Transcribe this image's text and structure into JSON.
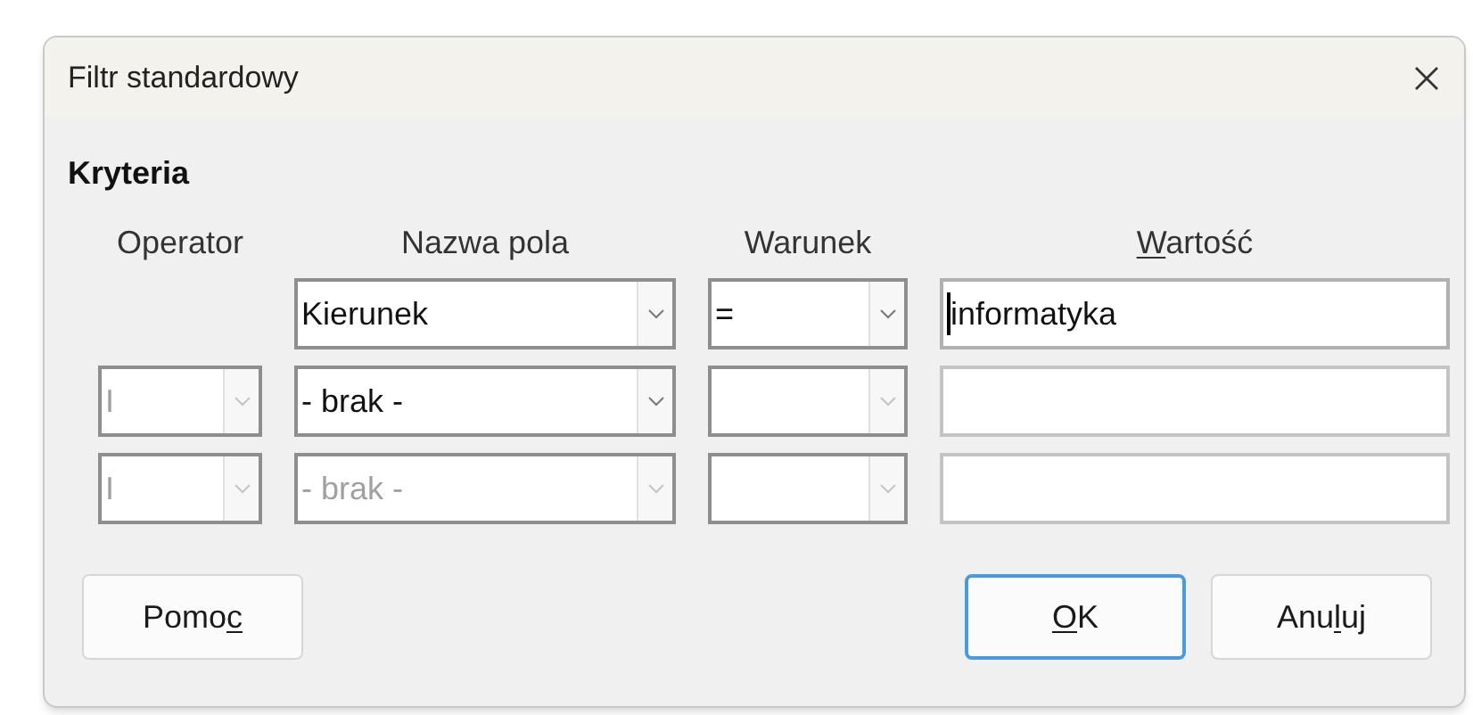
{
  "window": {
    "title": "Filtr standardowy"
  },
  "section": {
    "title": "Kryteria"
  },
  "columns": [
    {
      "text_before": "Operator"
    },
    {
      "text_before": "Nazwa pola"
    },
    {
      "text_before": "Warunek"
    },
    {
      "accesskey": "W",
      "text_after": "artość"
    }
  ],
  "rows": [
    {
      "operator": null,
      "field": {
        "value": "Kierunek",
        "disabled": false
      },
      "condition": {
        "value": "=",
        "disabled": false
      },
      "value": {
        "value": "informatyka",
        "focused": true
      }
    },
    {
      "operator": {
        "value": "I",
        "disabled": true
      },
      "field": {
        "value": "- brak -",
        "disabled": false
      },
      "condition": {
        "disabled": true
      },
      "value": {
        "focused": false
      }
    },
    {
      "operator": {
        "value": "I",
        "disabled": true
      },
      "field": {
        "value": "- brak -",
        "disabled": true
      },
      "condition": {
        "disabled": true
      },
      "value": {
        "focused": false
      }
    }
  ],
  "buttons": [
    {
      "text_before": "Pomo",
      "accesskey": "c",
      "default": false,
      "kind": "help"
    },
    {
      "accesskey": "O",
      "text_after": "K",
      "default": true,
      "kind": "action"
    },
    {
      "text_before": "Anu",
      "accesskey": "l",
      "text_after": "uj",
      "default": false,
      "kind": "action"
    }
  ]
}
